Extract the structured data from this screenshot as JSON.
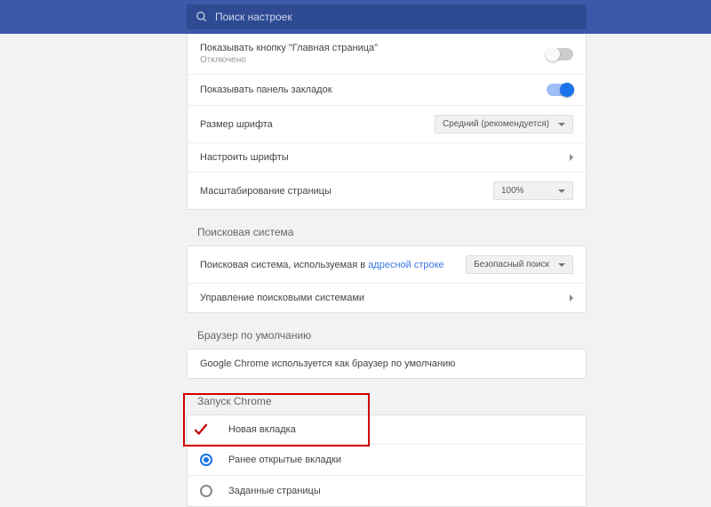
{
  "search": {
    "placeholder": "Поиск настроек"
  },
  "appearance": {
    "home_button_label": "Показывать кнопку \"Главная страница\"",
    "home_button_status": "Отключено",
    "home_button_on": false,
    "bookmarks_bar_label": "Показывать панель закладок",
    "bookmarks_bar_on": true,
    "font_size_label": "Размер шрифта",
    "font_size_value": "Средний (рекомендуется)",
    "customize_fonts_label": "Настроить шрифты",
    "page_zoom_label": "Масштабирование страницы",
    "page_zoom_value": "100%"
  },
  "search_engine": {
    "title": "Поисковая система",
    "row1_prefix": "Поисковая система, используемая в ",
    "row1_link": "адресной строке",
    "row1_value": "Безопасный поиск",
    "row2_label": "Управление поисковыми системами"
  },
  "default_browser": {
    "title": "Браузер по умолчанию",
    "text": "Google Chrome используется как браузер по умолчанию"
  },
  "startup": {
    "title": "Запуск Chrome",
    "options": [
      {
        "label": "Новая вкладка",
        "selected": false
      },
      {
        "label": "Ранее открытые вкладки",
        "selected": true
      },
      {
        "label": "Заданные страницы",
        "selected": false
      }
    ]
  }
}
